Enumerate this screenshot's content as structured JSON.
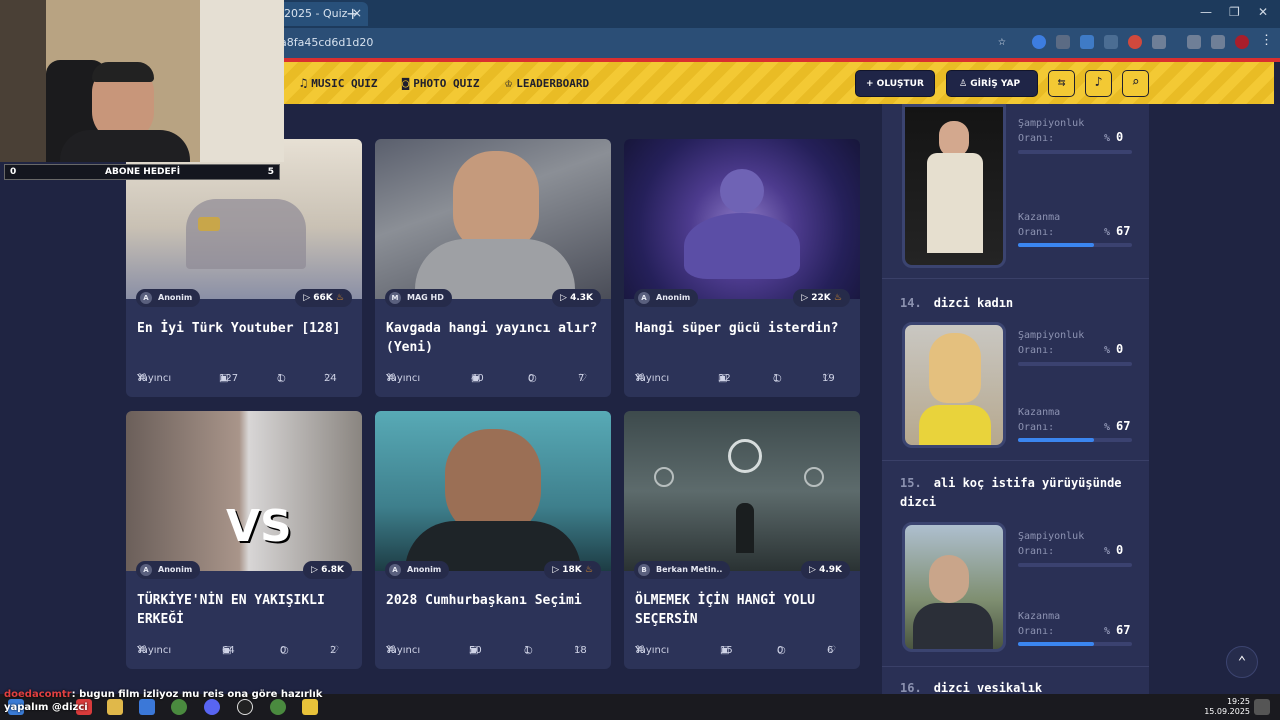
{
  "browser": {
    "tab_title": "2025 - Quiz",
    "url": "a8fa45cd6d1d20"
  },
  "nav": {
    "links": [
      {
        "icon": "music-icon",
        "label": "MUSIC QUIZ"
      },
      {
        "icon": "camera-icon",
        "label": "PHOTO QUIZ"
      },
      {
        "icon": "trophy-icon",
        "label": "LEADERBOARD"
      }
    ],
    "create_label": "+ OLUŞTUR",
    "login_label": "GİRİŞ YAP"
  },
  "cards": [
    {
      "author": "Anonim",
      "author_initial": "A",
      "plays": "66K",
      "hot": true,
      "title": "En İyi Türk Youtuber [128]",
      "creator": "Yayıncı",
      "questions": "127",
      "comments": "1",
      "likes": "24"
    },
    {
      "author": "MAG HD",
      "author_initial": "M",
      "plays": "4.3K",
      "hot": false,
      "title": "Kavgada hangi yayıncı alır? (Yeni)",
      "creator": "Yayıncı",
      "questions": "40",
      "comments": "0",
      "likes": "7"
    },
    {
      "author": "Anonim",
      "author_initial": "A",
      "plays": "22K",
      "hot": true,
      "title": "Hangi süper gücü isterdin?",
      "creator": "Yayıncı",
      "questions": "32",
      "comments": "1",
      "likes": "19"
    },
    {
      "author": "Anonim",
      "author_initial": "A",
      "plays": "6.8K",
      "hot": false,
      "title": "TÜRKİYE'NİN EN YAKIŞIKLI ERKEĞİ",
      "creator": "Yayıncı",
      "questions": "64",
      "comments": "0",
      "likes": "2"
    },
    {
      "author": "Anonim",
      "author_initial": "A",
      "plays": "18K",
      "hot": true,
      "title": "2028 Cumhurbaşkanı Seçimi",
      "creator": "Yayıncı",
      "questions": "50",
      "comments": "1",
      "likes": "18"
    },
    {
      "author": "Berkan Metin..",
      "author_initial": "B",
      "plays": "4.9K",
      "hot": false,
      "title": "ÖLMEMEK İÇİN HANGİ YOLU SEÇERSİN",
      "creator": "Yayıncı",
      "questions": "15",
      "comments": "0",
      "likes": "6"
    }
  ],
  "ranking": {
    "champ_label_1": "Şampiyonluk",
    "champ_label_2": "Oranı:",
    "win_label_1": "Kazanma",
    "win_label_2": "Oranı:",
    "pct_sign": "%",
    "entries": [
      {
        "num": "",
        "name": "",
        "champ_rate": "0",
        "win_rate": "67",
        "win_fraction": 0.67
      },
      {
        "num": "14.",
        "name": "dizci kadın",
        "champ_rate": "0",
        "win_rate": "67",
        "win_fraction": 0.67
      },
      {
        "num": "15.",
        "name": "ali koç istifa yürüyüşünde dizci",
        "champ_rate": "0",
        "win_rate": "67",
        "win_fraction": 0.67
      },
      {
        "num": "16.",
        "name": "dizci vesikalık"
      }
    ]
  },
  "stream": {
    "sub_goal_label": "ABONE HEDEFİ",
    "sub_goal_current": "0",
    "sub_goal_target": "5",
    "chat_user": "doedacomtr",
    "chat_message": ": bugun film izliyoz mu reis ona göre hazırlık",
    "chat_line2": "yapalım @dizci"
  },
  "taskbar": {
    "time": "19:25",
    "date": "15.09.2025"
  }
}
